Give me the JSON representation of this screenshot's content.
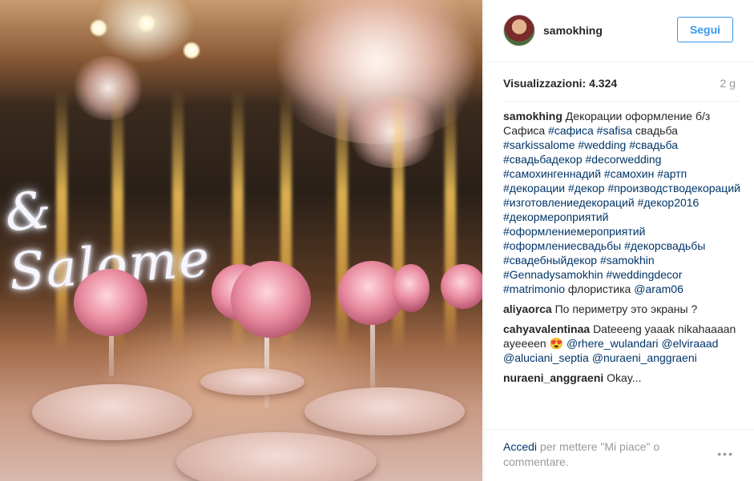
{
  "photo": {
    "overlay_text": "& Salome"
  },
  "post": {
    "username": "samokhing",
    "follow_label": "Segui",
    "views_label": "Visualizzazioni:",
    "views_value": "4.324",
    "time_ago": "2 g"
  },
  "caption": {
    "author": "samokhing",
    "text_1": "Декорации оформление б/з Сафиса",
    "tags_1": [
      "#сафиса",
      "#safisa"
    ],
    "text_2": "свадьба",
    "tags_2": [
      "#sarkissalome",
      "#wedding",
      "#свадьба",
      "#свадьбадекор",
      "#decorwedding",
      "#самохингеннадий",
      "#самохин",
      "#артп",
      "#декорации",
      "#декор",
      "#производстводекораций",
      "#изготовлениедекораций",
      "#декор2016",
      "#декормероприятий",
      "#оформлениемероприятий",
      "#оформлениесвадьбы",
      "#декорсвадьбы",
      "#свадебныйдекор",
      "#samokhin",
      "#Gennadysamokhin",
      "#weddingdecor",
      "#matrimonio"
    ],
    "text_3": "флористика",
    "mention": "@aram06"
  },
  "comments": [
    {
      "author": "aliyaorca",
      "text": "По периметру это экраны ?"
    },
    {
      "author": "cahyavalentinaa",
      "text": "Dateeeng yaaak nikahaaaan ayeeeen 😍",
      "mentions": [
        "@rhere_wulandari",
        "@elviraaad",
        "@aluciani_septia",
        "@nuraeni_anggraeni"
      ]
    },
    {
      "author": "nuraeni_anggraeni",
      "text": "Okay..."
    }
  ],
  "footer": {
    "login_link": "Accedi",
    "login_text": "per mettere \"Mi piace\" o commentare.",
    "more_icon": "•••"
  },
  "colors": {
    "accent": "#3897f0",
    "link": "#003569",
    "muted": "#999999",
    "text": "#262626"
  }
}
